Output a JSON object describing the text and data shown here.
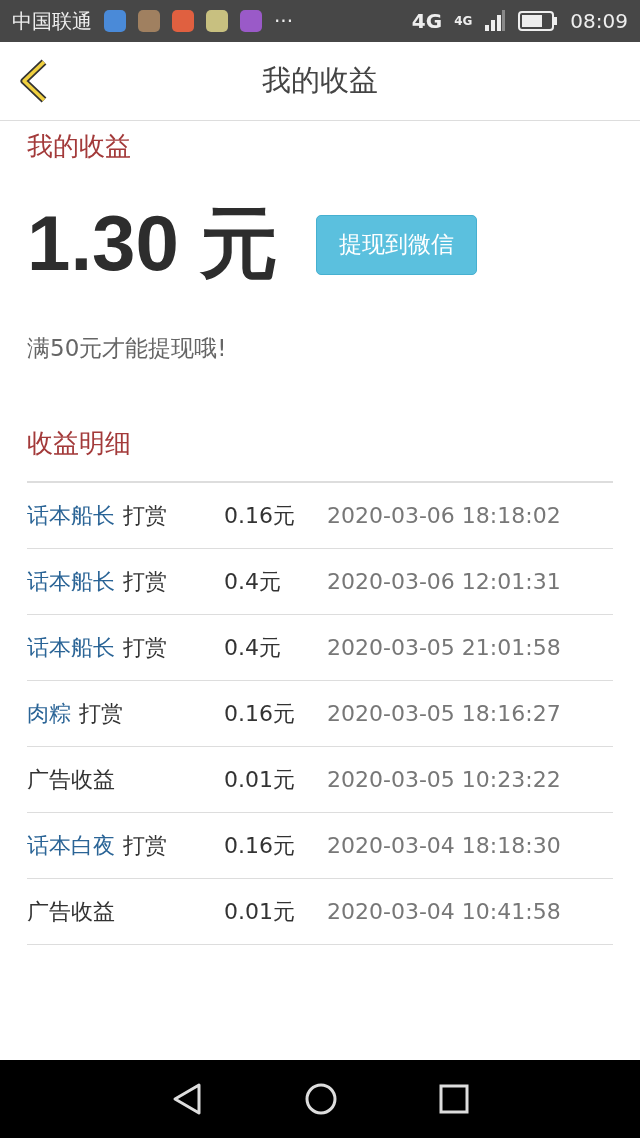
{
  "status_bar": {
    "carrier": "中国联通",
    "more": "···",
    "network_1": "4G",
    "network_2": "4G",
    "time": "08:09"
  },
  "header": {
    "title": "我的收益"
  },
  "earnings": {
    "heading": "我的收益",
    "amount": "1.30 元",
    "withdraw_button": "提现到微信",
    "note": "满50元才能提现哦!"
  },
  "details": {
    "heading": "收益明细",
    "rows": [
      {
        "kind": "reward",
        "name": "话本船长",
        "action": "打赏",
        "amount": "0.16元",
        "time": "2020-03-06 18:18:02"
      },
      {
        "kind": "reward",
        "name": "话本船长",
        "action": "打赏",
        "amount": "0.4元",
        "time": "2020-03-06 12:01:31"
      },
      {
        "kind": "reward",
        "name": "话本船长",
        "action": "打赏",
        "amount": "0.4元",
        "time": "2020-03-05 21:01:58"
      },
      {
        "kind": "reward",
        "name": "肉粽",
        "action": "打赏",
        "amount": "0.16元",
        "time": "2020-03-05 18:16:27"
      },
      {
        "kind": "ad",
        "name": "广告收益",
        "amount": "0.01元",
        "time": "2020-03-05 10:23:22"
      },
      {
        "kind": "reward",
        "name": "话本白夜",
        "action": "打赏",
        "amount": "0.16元",
        "time": "2020-03-04 18:18:30"
      },
      {
        "kind": "ad",
        "name": "广告收益",
        "amount": "0.01元",
        "time": "2020-03-04 10:41:58"
      }
    ]
  }
}
